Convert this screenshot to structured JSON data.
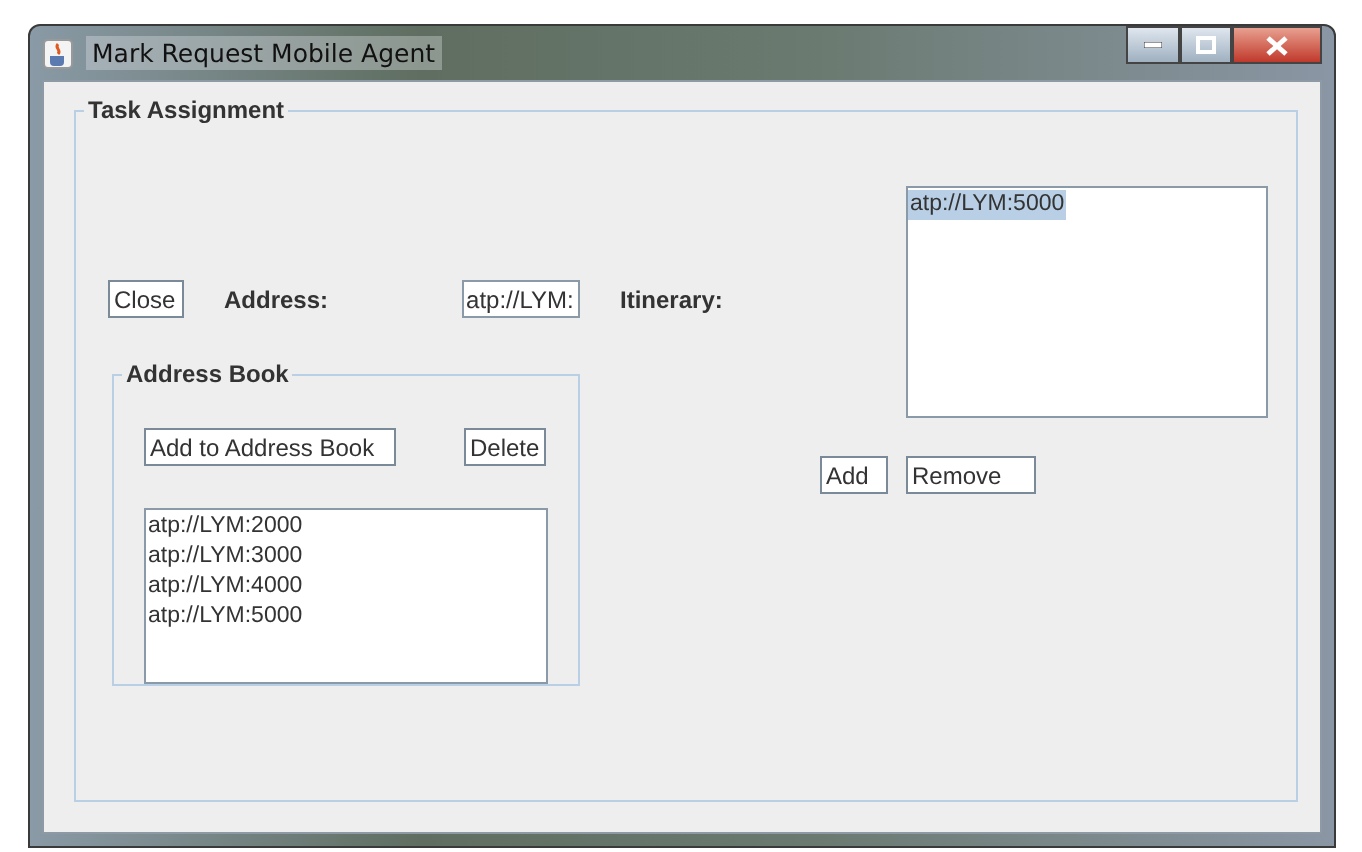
{
  "window": {
    "title": "Mark Request Mobile Agent"
  },
  "task_assignment": {
    "title": "Task Assignment",
    "close_button": "Close",
    "address_label": "Address:",
    "address_field": {
      "value": "atp://LYM:"
    },
    "itinerary_label": "Itinerary:",
    "itinerary": [
      {
        "text": "atp://LYM:5000",
        "selected": true
      }
    ],
    "add_button": "Add",
    "remove_button": "Remove",
    "address_book": {
      "title": "Address Book",
      "add_button": "Add to Address Book",
      "delete_button": "Delete",
      "items": [
        {
          "text": "atp://LYM:2000",
          "selected": false
        },
        {
          "text": "atp://LYM:3000",
          "selected": false
        },
        {
          "text": "atp://LYM:4000",
          "selected": false
        },
        {
          "text": "atp://LYM:5000",
          "selected": false
        }
      ]
    }
  }
}
